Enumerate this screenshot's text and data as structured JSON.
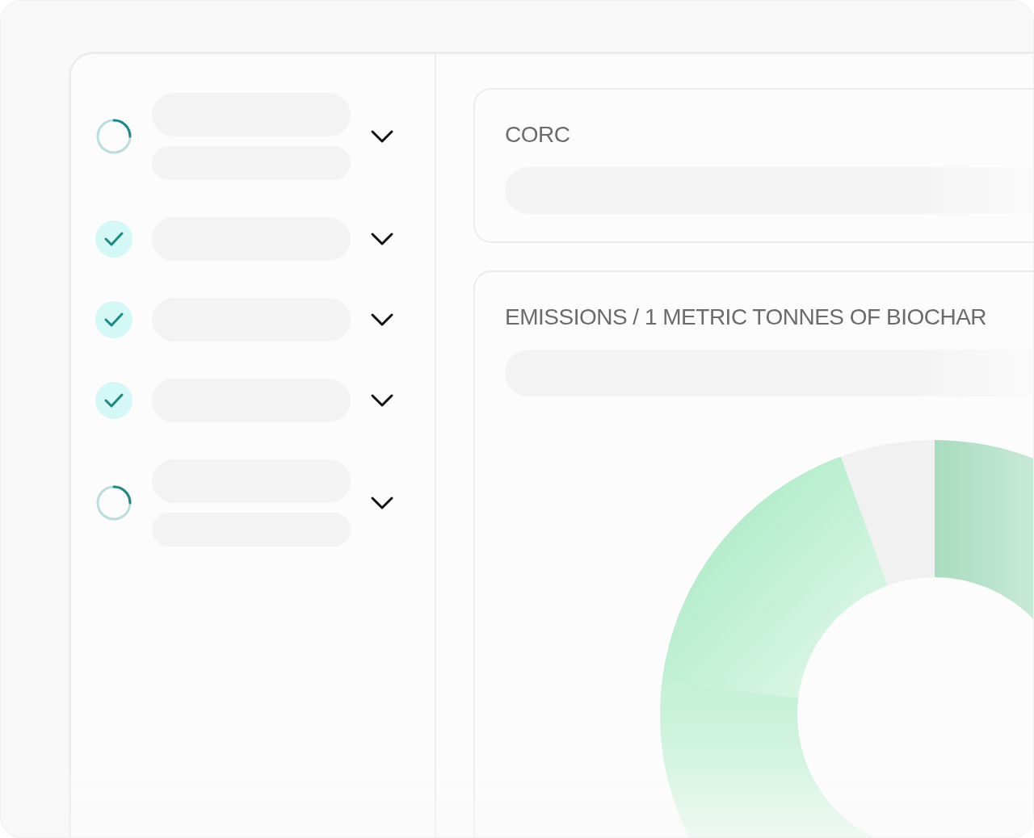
{
  "steps": [
    {
      "kind": "two-line",
      "checked": false
    },
    {
      "kind": "one-line",
      "checked": true
    },
    {
      "kind": "one-line",
      "checked": true
    },
    {
      "kind": "one-line",
      "checked": true
    },
    {
      "kind": "two-line",
      "checked": false
    }
  ],
  "cards": [
    {
      "title": "CORC"
    },
    {
      "title": "EMISSIONS / 1 METRIC TONNES OF BIOCHAR"
    }
  ]
}
